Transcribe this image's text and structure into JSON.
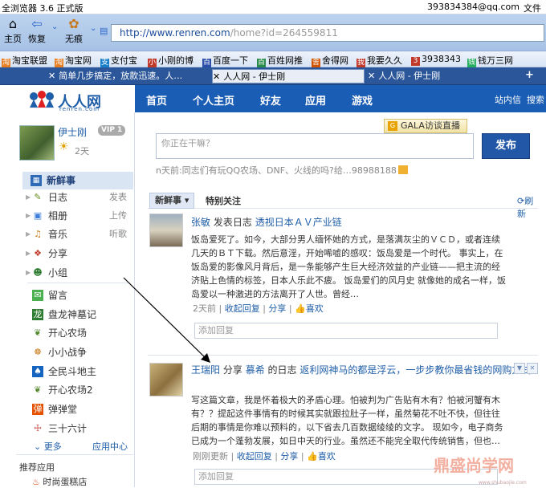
{
  "browser": {
    "title": "全浏览器 3.6 正式版",
    "account": "393834384@qq.com",
    "file_menu": "文件",
    "buttons": {
      "home": "主页",
      "restore": "恢复",
      "traceless": "无痕"
    },
    "address": {
      "prefix": "http://www.renren.com",
      "suffix": "/home?id=264559811"
    },
    "favorites": [
      "淘宝联盟",
      "淘宝网",
      "支付宝",
      "小刚的博",
      "百度一下",
      "百姓网推",
      "舍得网",
      "我要久久",
      "3938343",
      "钱万三网"
    ],
    "tabs": [
      {
        "label": "简单几步搞定，放款迅速。人…",
        "active": false
      },
      {
        "label": "人人网 - 伊士刚",
        "active": true
      },
      {
        "label": "人人网 - 伊士刚",
        "active": false
      }
    ]
  },
  "site": {
    "logo_text": "人人网",
    "logo_sub": "renren.com",
    "nav": [
      "首页",
      "个人主页",
      "好友",
      "应用",
      "游戏"
    ],
    "nav_right": [
      "站内信",
      "搜索"
    ]
  },
  "profile": {
    "name": "伊士刚",
    "vip": "VIP 1",
    "days": "2天"
  },
  "sidebar": {
    "new_feed": "新鲜事",
    "items": [
      {
        "label": "日志",
        "action": "发表",
        "icon": "journal-icon"
      },
      {
        "label": "相册",
        "action": "上传",
        "icon": "album-icon"
      },
      {
        "label": "音乐",
        "action": "听歌",
        "icon": "music-icon"
      },
      {
        "label": "分享",
        "action": "",
        "icon": "share-icon"
      },
      {
        "label": "小组",
        "action": "",
        "icon": "group-icon"
      }
    ],
    "apps": [
      "留言",
      "盘龙神墓记",
      "开心农场",
      "小小战争",
      "全民斗地主",
      "开心农场2",
      "弹弹堂",
      "三十六计"
    ],
    "more": "更多",
    "app_center": "应用中心",
    "recommended": "推荐应用",
    "recommended_first": "时尚蛋糕店"
  },
  "main": {
    "gala": "GALA访谈直播",
    "status_placeholder": "你正在干嘛？",
    "publish": "发布",
    "hint": "n天前:同志们有玩QQ农场、DNF、火线的吗?给…98988188",
    "tab_new": "新鲜事",
    "tab_focus": "特别关注",
    "refresh": "刷新",
    "feeds": [
      {
        "user": "张敏",
        "verb": "发表日志",
        "title": "透视日本ＡＶ产业链",
        "body": "饭岛爱死了。如今，大部分男人缅怀她的方式，是落满灰尘的ＶＣＤ，或者连续几天的ＢＴ下载。然后意淫，开始唏嘘的感叹：饭岛爱是一个时代。 事实上，在饭岛爱的影像风月背后，是一条能够产生巨大经济效益的产业链——把主流的经济贴上色情的标签，日本人乐此不疲。 饭岛爱们的风月史 就像她的成名一样，饭岛爱以一种激进的方法离开了人世。曾经…",
        "time": "2天前",
        "collapse": "收起回复",
        "share": "分享",
        "like": "喜欢",
        "reply_placeholder": "添加回复"
      },
      {
        "user": "王瑞阳",
        "verb": "分享",
        "owner": "慕希",
        "mid": "的日志",
        "title": "返利网神马的都是浮云，一步步教你最省钱的网购方式",
        "body": "写这篇文章，我是怀着极大的矛盾心理。怕被判为广告贴有木有？怕被河蟹有木有？？提起这件事情有的时候其实就跟拉肚子一样，虽然菊花不吐不快，但往往后期的事情是你难以预料的，以下省去几百数据绫绫的文字。 现如今，电子商务已成为一个蓬勃发展，如日中天的行业。虽然还不能完全取代传统销售，但也…",
        "time": "刚刚更新",
        "collapse": "收起回复",
        "share": "分享",
        "like": "喜欢",
        "reply_placeholder": "添加回复"
      }
    ]
  },
  "watermark": {
    "main": "鼎盛尚学网",
    "sub": "www.shubaojie.com"
  }
}
